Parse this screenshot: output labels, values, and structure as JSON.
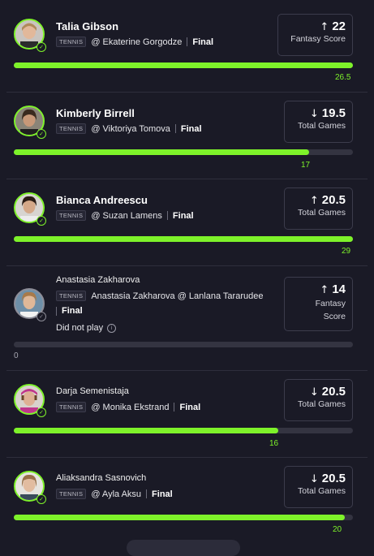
{
  "colors": {
    "accent": "#7ef22a",
    "background": "#1a1a26",
    "track": "#343441"
  },
  "players": [
    {
      "name": "Talia Gibson",
      "sport": "TENNIS",
      "matchup": "@ Ekaterine Gorgodze",
      "status": "Final",
      "direction": "↑",
      "line": "22",
      "stat": "Fantasy Score",
      "result": "26.5",
      "progress": 1.0,
      "played": true
    },
    {
      "name": "Kimberly Birrell",
      "sport": "TENNIS",
      "matchup": "@ Viktoriya Tomova",
      "status": "Final",
      "direction": "↓",
      "line": "19.5",
      "stat": "Total Games",
      "result": "17",
      "progress": 0.87,
      "played": true
    },
    {
      "name": "Bianca Andreescu",
      "sport": "TENNIS",
      "matchup": "@ Suzan Lamens",
      "status": "Final",
      "direction": "↑",
      "line": "20.5",
      "stat": "Total Games",
      "result": "29",
      "progress": 1.0,
      "played": true
    },
    {
      "name": "Anastasia Zakharova",
      "sport": "TENNIS",
      "matchup": "Anastasia Zakharova @ Lanlana Tararudee",
      "status": "Final",
      "direction": "↑",
      "line": "14",
      "stat_line1": "Fantasy",
      "stat_line2": "Score",
      "result": "0",
      "progress": 0,
      "played": false,
      "note": "Did not play"
    },
    {
      "name": "Darja Semenistaja",
      "sport": "TENNIS",
      "matchup": "@ Monika Ekstrand",
      "status": "Final",
      "direction": "↓",
      "line": "20.5",
      "stat": "Total Games",
      "result": "16",
      "progress": 0.78,
      "played": true
    },
    {
      "name": "Aliaksandra Sasnovich",
      "sport": "TENNIS",
      "matchup": "@ Ayla Aksu",
      "status": "Final",
      "direction": "↓",
      "line": "20.5",
      "stat": "Total Games",
      "result": "20",
      "progress": 0.975,
      "played": true
    }
  ]
}
